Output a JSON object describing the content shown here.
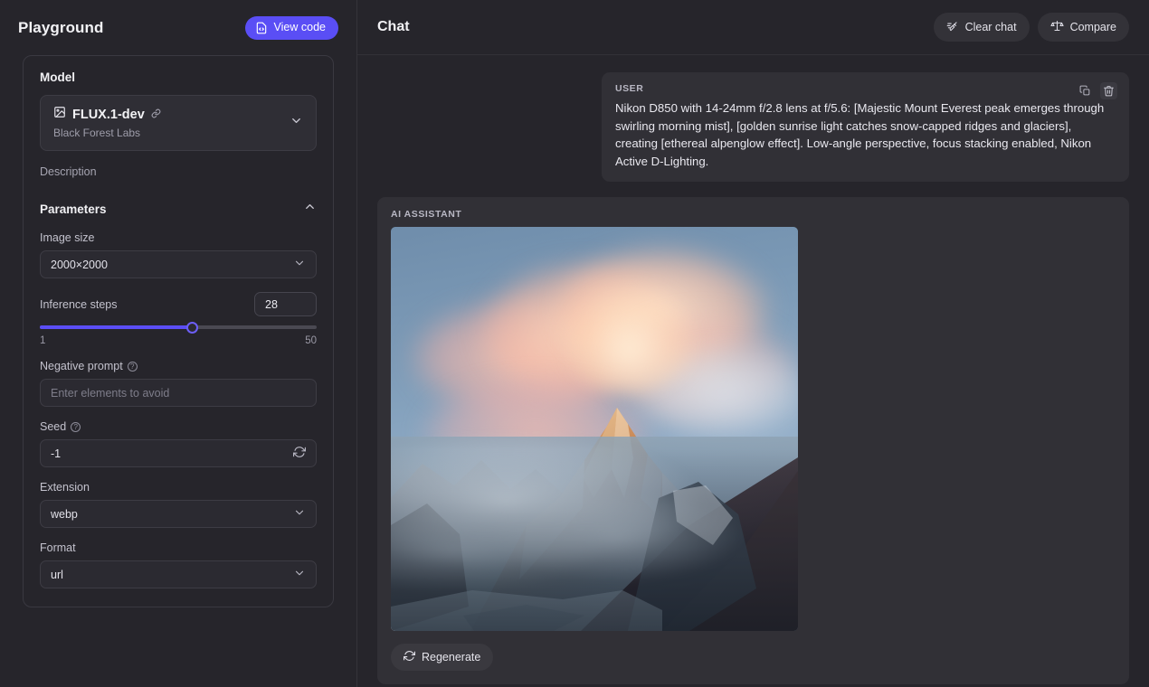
{
  "left": {
    "title": "Playground",
    "view_code_label": "View code",
    "model_section_label": "Model",
    "model_name": "FLUX.1-dev",
    "model_vendor": "Black Forest Labs",
    "description_label": "Description",
    "parameters_label": "Parameters",
    "fields": {
      "image_size_label": "Image size",
      "image_size_value": "2000×2000",
      "inference_steps_label": "Inference steps",
      "inference_steps_value": "28",
      "inference_steps_min": "1",
      "inference_steps_max": "50",
      "negative_prompt_label": "Negative prompt",
      "negative_prompt_placeholder": "Enter elements to avoid",
      "negative_prompt_value": "",
      "seed_label": "Seed",
      "seed_value": "-1",
      "extension_label": "Extension",
      "extension_value": "webp",
      "format_label": "Format",
      "format_value": "url"
    }
  },
  "right": {
    "title": "Chat",
    "clear_chat_label": "Clear chat",
    "compare_label": "Compare",
    "user_message": {
      "role": "USER",
      "text": "Nikon D850 with 14-24mm f/2.8 lens at f/5.6: [Majestic Mount Everest peak emerges through swirling morning mist], [golden sunrise light catches snow-capped ridges and glaciers], creating [ethereal alpenglow effect]. Low-angle perspective, focus stacking enabled, Nikon Active D-Lighting."
    },
    "assistant_message": {
      "role": "AI ASSISTANT",
      "image_alt": "Snow-capped mountain peak at sunrise with alpenglow clouds and misty valley",
      "regenerate_label": "Regenerate"
    }
  },
  "colors": {
    "accent": "#5a4ef5",
    "page_bg": "#26252b",
    "panel_bg": "#313036",
    "input_bg": "#2b2a31",
    "border": "#3d3c44",
    "text_primary": "#f2f2f5",
    "text_muted": "#9e9daa"
  }
}
